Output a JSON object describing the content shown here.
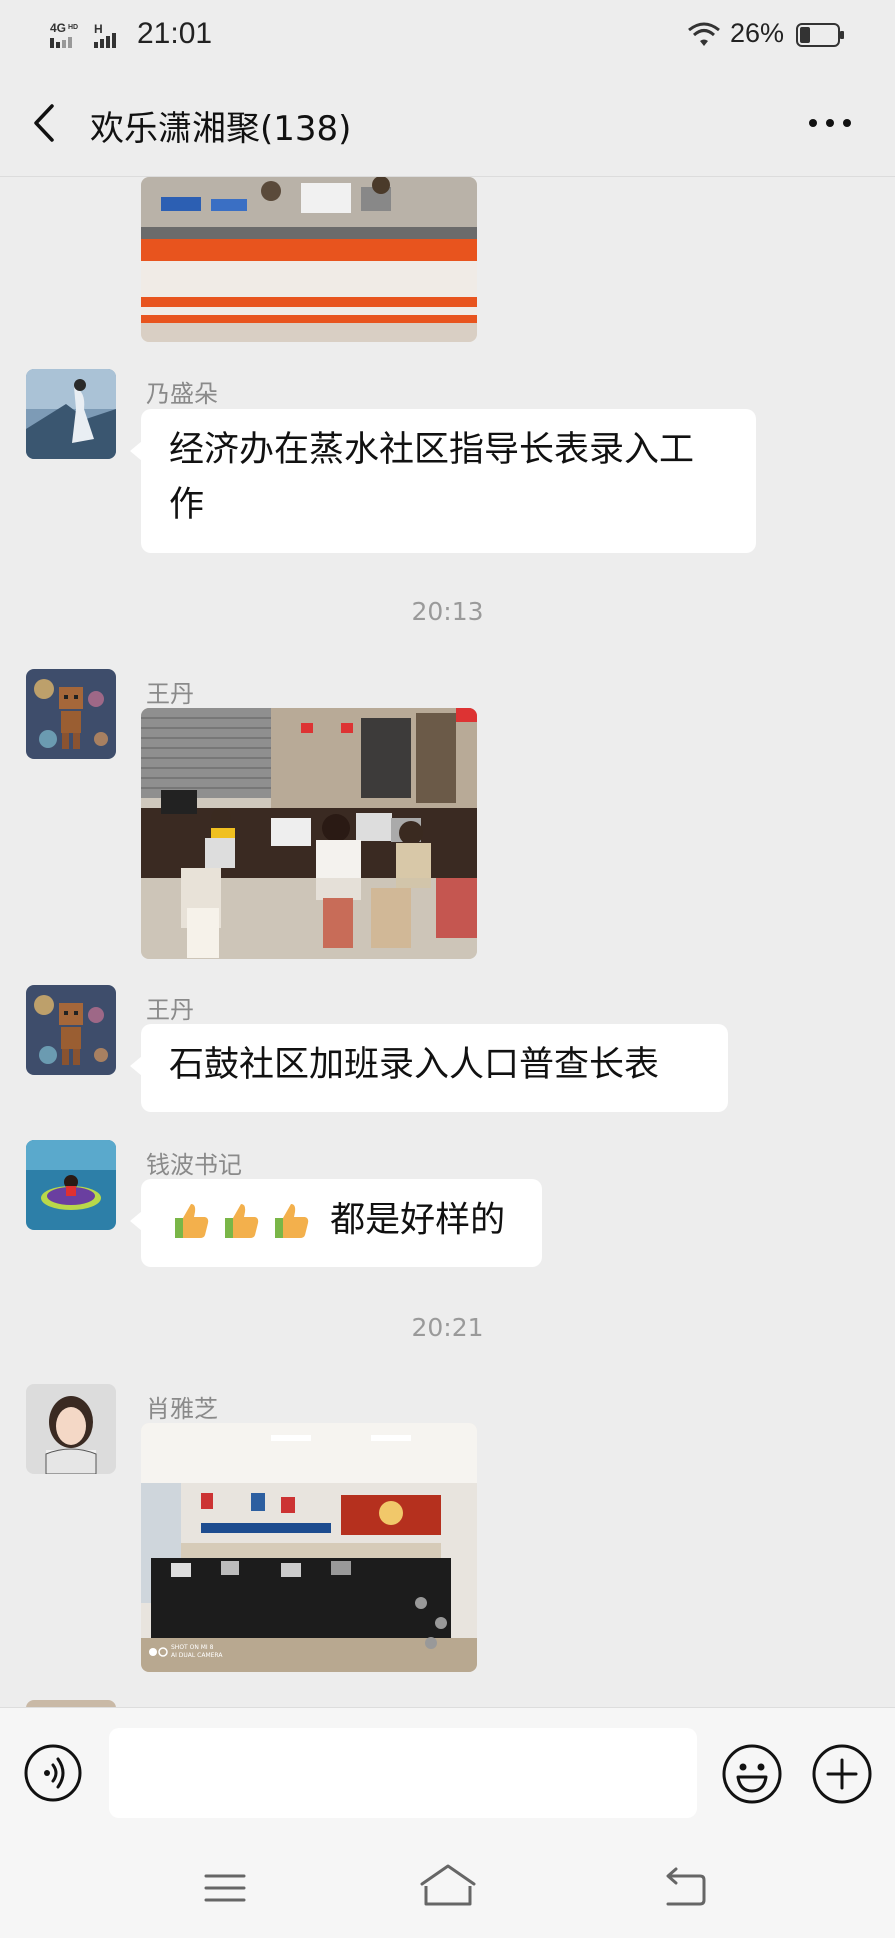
{
  "status_bar": {
    "network": "4GHD H",
    "time": "21:01",
    "battery": "26%"
  },
  "header": {
    "title": "欢乐潇湘聚(138)",
    "back_icon": "chevron-left-icon",
    "more_icon": "more-dots-icon"
  },
  "messages": [
    {
      "type": "image",
      "sender": "",
      "description": "partial photo of office counter with orange stripes"
    },
    {
      "type": "text",
      "sender": "乃盛朵",
      "text": "经济办在蒸水社区指导长表录入工作"
    },
    {
      "type": "time",
      "text": "20:13"
    },
    {
      "type": "image",
      "sender": "王丹",
      "description": "photo of staff working at computers in office"
    },
    {
      "type": "text",
      "sender": "王丹",
      "text": "石鼓社区加班录入人口普查长表"
    },
    {
      "type": "text",
      "sender": "钱波书记",
      "emoji": "thumbs-up-icon",
      "emoji_count": 3,
      "text": "都是好样的"
    },
    {
      "type": "time",
      "text": "20:21"
    },
    {
      "type": "image",
      "sender": "肖雅芝",
      "description": "photo of service hall with black counters",
      "watermark_line1": "SHOT ON MI 8",
      "watermark_line2": "AI DUAL CAMERA"
    }
  ],
  "input_bar": {
    "voice_icon": "voice-icon",
    "input_value": "",
    "emoji_icon": "emoji-icon",
    "plus_icon": "plus-icon"
  },
  "nav_bar": {
    "menu_icon": "menu-icon",
    "home_icon": "home-icon",
    "back_icon": "back-icon"
  },
  "colors": {
    "background": "#ededed",
    "bubble": "#ffffff",
    "sender_text": "#8a8a8a"
  }
}
